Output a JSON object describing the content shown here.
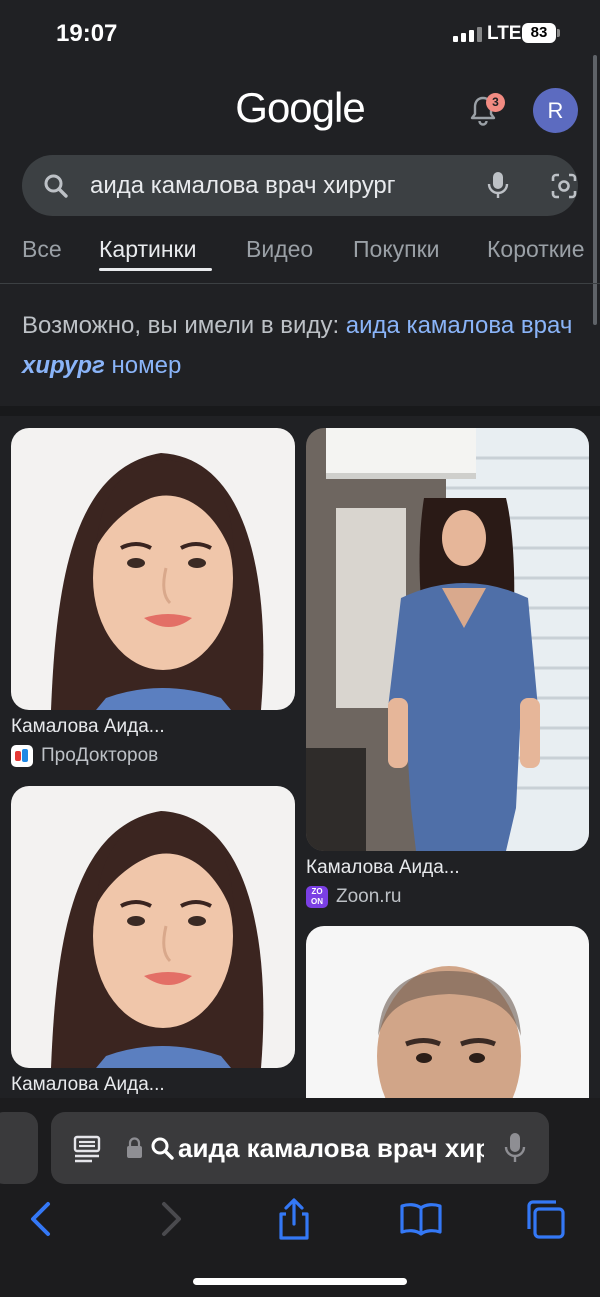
{
  "status_bar": {
    "time": "19:07",
    "network": "LTE",
    "battery": "83"
  },
  "header": {
    "logo": "Google",
    "notifications_count": "3",
    "avatar_letter": "R"
  },
  "search": {
    "query": "аида камалова врач хирург"
  },
  "tabs": [
    {
      "label": "Все",
      "active": false
    },
    {
      "label": "Картинки",
      "active": true
    },
    {
      "label": "Видео",
      "active": false
    },
    {
      "label": "Покупки",
      "active": false
    },
    {
      "label": "Короткие",
      "active": false
    }
  ],
  "suggestion": {
    "prefix": "Возможно, вы имели в виду:",
    "part1": "аида камалова врач",
    "emphasis": "хирург",
    "part2": "номер"
  },
  "results": [
    {
      "caption": "Камалова Аида...",
      "source": "ПроДокторов"
    },
    {
      "caption": "Камалова Аида...",
      "source": "Zoon.ru"
    },
    {
      "caption": "Камалова Аида...",
      "source": ""
    },
    {
      "caption": "",
      "source": ""
    }
  ],
  "browser": {
    "url_text": "аида камалова врач хирург"
  },
  "colors": {
    "background": "#202124",
    "link": "#8ab4f8",
    "search_bg": "#3c4043",
    "safari_blue": "#3478f6"
  }
}
